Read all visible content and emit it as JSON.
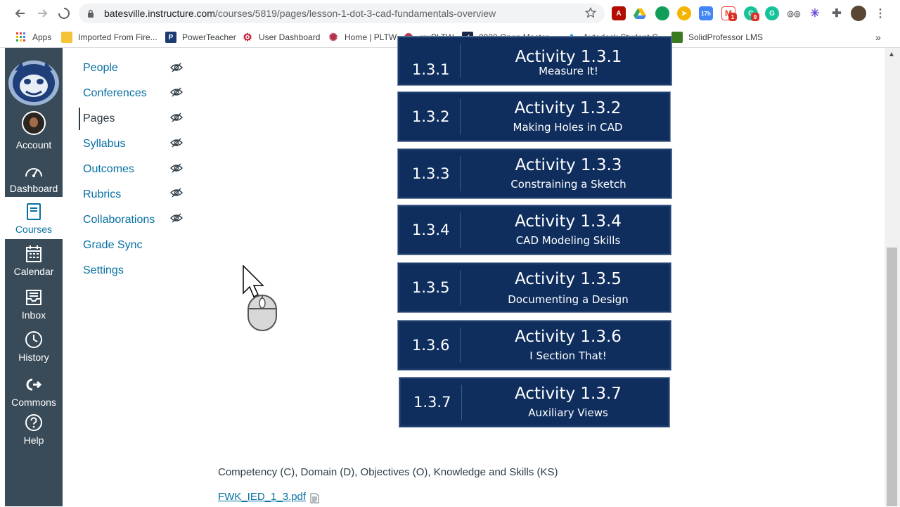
{
  "browser": {
    "url_host": "batesville.instructure.com",
    "url_path": "/courses/5819/pages/lesson-1-dot-3-cad-fundamentals-overview",
    "bookmarks": [
      {
        "label": "Apps",
        "icon": "apps-grid-icon"
      },
      {
        "label": "Imported From Fire...",
        "icon": "folder-icon"
      },
      {
        "label": "PowerTeacher",
        "icon": "powerteacher-icon"
      },
      {
        "label": "User Dashboard",
        "icon": "gear-icon"
      },
      {
        "label": "Home | PLTW",
        "icon": "pltw-icon"
      },
      {
        "label": "myPLTW",
        "icon": "pltw-icon"
      },
      {
        "label": "2020 Open Master...",
        "icon": "checkmark-icon"
      },
      {
        "label": "Autodesk Student C...",
        "icon": "autodesk-icon"
      },
      {
        "label": "SolidProfessor LMS",
        "icon": "solidprofessor-icon"
      }
    ],
    "bookmarks_more": "»",
    "extension_badges": {
      "calendar": "17h",
      "gmail": "1",
      "grammarly": "9"
    }
  },
  "global_nav": {
    "items": [
      {
        "label": "Account",
        "icon": "avatar"
      },
      {
        "label": "Dashboard",
        "icon": "dashboard-icon"
      },
      {
        "label": "Courses",
        "icon": "courses-icon"
      },
      {
        "label": "Calendar",
        "icon": "calendar-icon"
      },
      {
        "label": "Inbox",
        "icon": "inbox-icon"
      },
      {
        "label": "History",
        "icon": "history-icon"
      },
      {
        "label": "Commons",
        "icon": "commons-icon"
      },
      {
        "label": "Help",
        "icon": "help-icon"
      }
    ],
    "active": "Courses"
  },
  "course_nav": {
    "items": [
      {
        "label": "People",
        "hidden": true
      },
      {
        "label": "Conferences",
        "hidden": true
      },
      {
        "label": "Pages",
        "hidden": true
      },
      {
        "label": "Syllabus",
        "hidden": true
      },
      {
        "label": "Outcomes",
        "hidden": true
      },
      {
        "label": "Rubrics",
        "hidden": true
      },
      {
        "label": "Collaborations",
        "hidden": true
      },
      {
        "label": "Grade Sync",
        "hidden": false
      },
      {
        "label": "Settings",
        "hidden": false
      }
    ],
    "active": "Pages"
  },
  "activities": [
    {
      "num": "1.3.1",
      "title": "Activity 1.3.1",
      "sub": "Measure It!"
    },
    {
      "num": "1.3.2",
      "title": "Activity 1.3.2",
      "sub": "Making Holes in CAD"
    },
    {
      "num": "1.3.3",
      "title": "Activity 1.3.3",
      "sub": "Constraining a Sketch"
    },
    {
      "num": "1.3.4",
      "title": "Activity 1.3.4",
      "sub": "CAD Modeling Skills"
    },
    {
      "num": "1.3.5",
      "title": "Activity 1.3.5",
      "sub": "Documenting a Design"
    },
    {
      "num": "1.3.6",
      "title": "Activity 1.3.6",
      "sub": "I Section That!"
    },
    {
      "num": "1.3.7",
      "title": "Activity 1.3.7",
      "sub": "Auxiliary Views"
    }
  ],
  "content": {
    "competency_heading": "Competency (C), Domain (D), Objectives (O), Knowledge and Skills (KS)",
    "pdf_link": "FWK_IED_1_3.pdf"
  },
  "colors": {
    "nav_bg": "#394b58",
    "link": "#0770a3",
    "activity_bg": "#0f2e5e"
  }
}
